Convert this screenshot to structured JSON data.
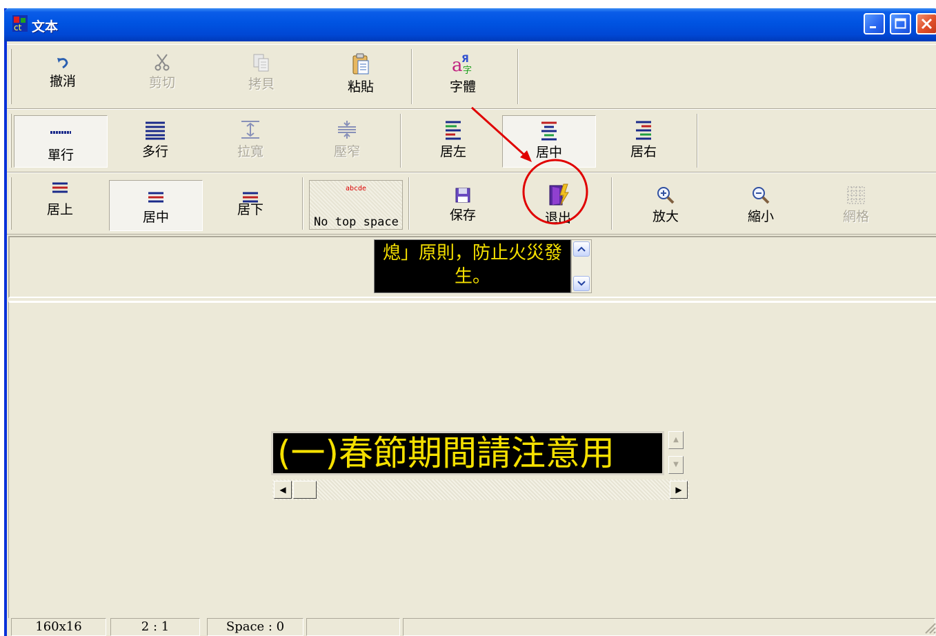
{
  "window": {
    "title": "文本",
    "controls": [
      "minimize",
      "maximize",
      "close"
    ]
  },
  "toolbar1": [
    {
      "label": "撤消",
      "icon": "undo-icon",
      "enabled": true
    },
    {
      "label": "剪切",
      "icon": "scissors-icon",
      "enabled": false
    },
    {
      "label": "拷貝",
      "icon": "copy-icon",
      "enabled": false
    },
    {
      "label": "粘貼",
      "icon": "paste-icon",
      "enabled": true
    },
    {
      "label": "字體",
      "icon": "font-icon",
      "enabled": true
    }
  ],
  "toolbar2": [
    {
      "label": "單行",
      "icon": "single-line-icon",
      "enabled": true,
      "pressed": true
    },
    {
      "label": "多行",
      "icon": "multi-line-icon",
      "enabled": true
    },
    {
      "label": "拉寬",
      "icon": "widen-icon",
      "enabled": false
    },
    {
      "label": "壓窄",
      "icon": "narrow-icon",
      "enabled": false
    },
    {
      "label": "居左",
      "icon": "align-left-icon",
      "enabled": true
    },
    {
      "label": "居中",
      "icon": "align-center-icon",
      "enabled": true,
      "pressed": true
    },
    {
      "label": "居右",
      "icon": "align-right-icon",
      "enabled": true
    }
  ],
  "toolbar3": [
    {
      "label": "居上",
      "icon": "align-top-icon",
      "enabled": true
    },
    {
      "label": "居中",
      "icon": "align-middle-icon",
      "enabled": true,
      "pressed": true
    },
    {
      "label": "居下",
      "icon": "align-bottom-icon",
      "enabled": true
    },
    {
      "label": "No top space",
      "preview": "abcde",
      "enabled": true
    },
    {
      "label": "保存",
      "icon": "save-icon",
      "enabled": true
    },
    {
      "label": "退出",
      "icon": "exit-door-icon",
      "enabled": true
    },
    {
      "label": "放大",
      "icon": "zoom-in-icon",
      "enabled": true
    },
    {
      "label": "縮小",
      "icon": "zoom-out-icon",
      "enabled": true
    },
    {
      "label": "網格",
      "icon": "grid-icon",
      "enabled": false
    }
  ],
  "preview": {
    "line1": "熄」原則，防止火災發",
    "line2": "生。"
  },
  "editor": {
    "text": "(一)春節期間請注意用"
  },
  "statusbar": {
    "size": "160x16",
    "ratio": "2 : 1",
    "space": "Space : 0"
  },
  "colors": {
    "led_background": "#000000",
    "led_text": "#f5e000",
    "annotation": "#e00000",
    "titlebar": "#0053e1"
  }
}
